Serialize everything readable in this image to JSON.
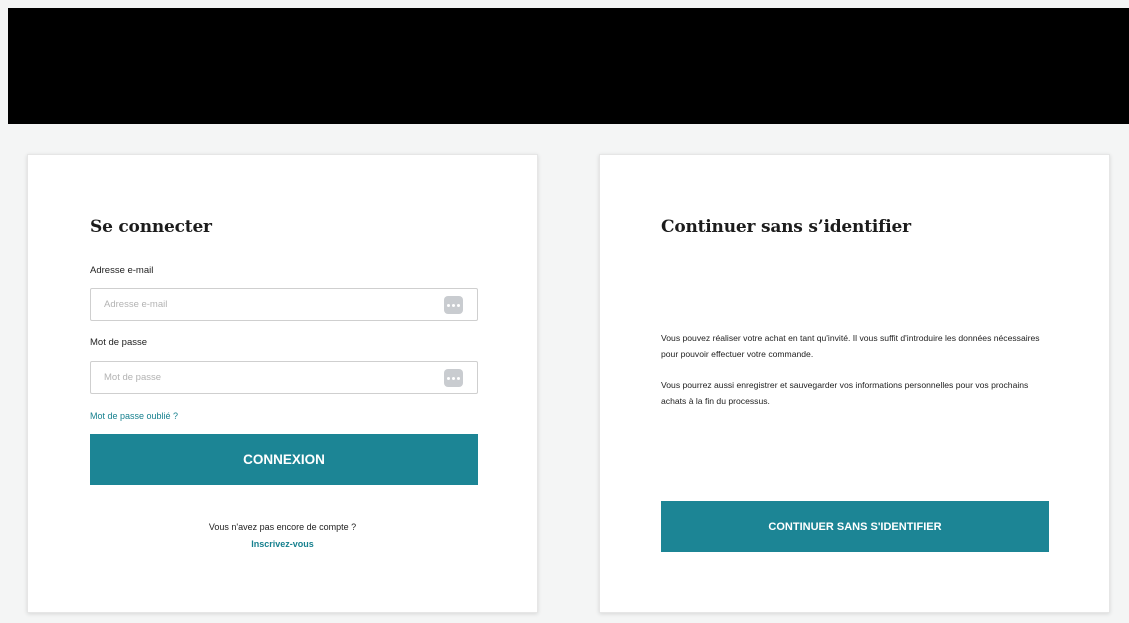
{
  "login": {
    "title": "Se connecter",
    "email_label": "Adresse e-mail",
    "email_placeholder": "Adresse e-mail",
    "email_value": "",
    "password_label": "Mot de passe",
    "password_placeholder": "Mot de passe",
    "password_value": "",
    "forgot_password": "Mot de passe oublié ?",
    "submit_label": "CONNEXION",
    "no_account_text": "Vous n'avez pas encore de compte ?",
    "signup_link": "Inscrivez-vous"
  },
  "guest": {
    "title": "Continuer sans s’identifier",
    "paragraph_1": "Vous pouvez réaliser votre achat en tant qu'invité. Il vous suffit d'introduire les données nécessaires pour pouvoir effectuer votre commande.",
    "paragraph_2": "Vous pourrez aussi enregistrer et sauvegarder vos informations personnelles pour vos prochains achats à la fin du processus.",
    "button_label": "CONTINUER SANS S'IDENTIFIER"
  },
  "icons": {
    "email_field_icon": "password-manager-dots-icon",
    "password_field_icon": "password-manager-dots-icon"
  },
  "colors": {
    "header": "#000000",
    "background": "#f4f5f5",
    "card": "#ffffff",
    "accent": "#1c8595",
    "link": "#17818f"
  }
}
